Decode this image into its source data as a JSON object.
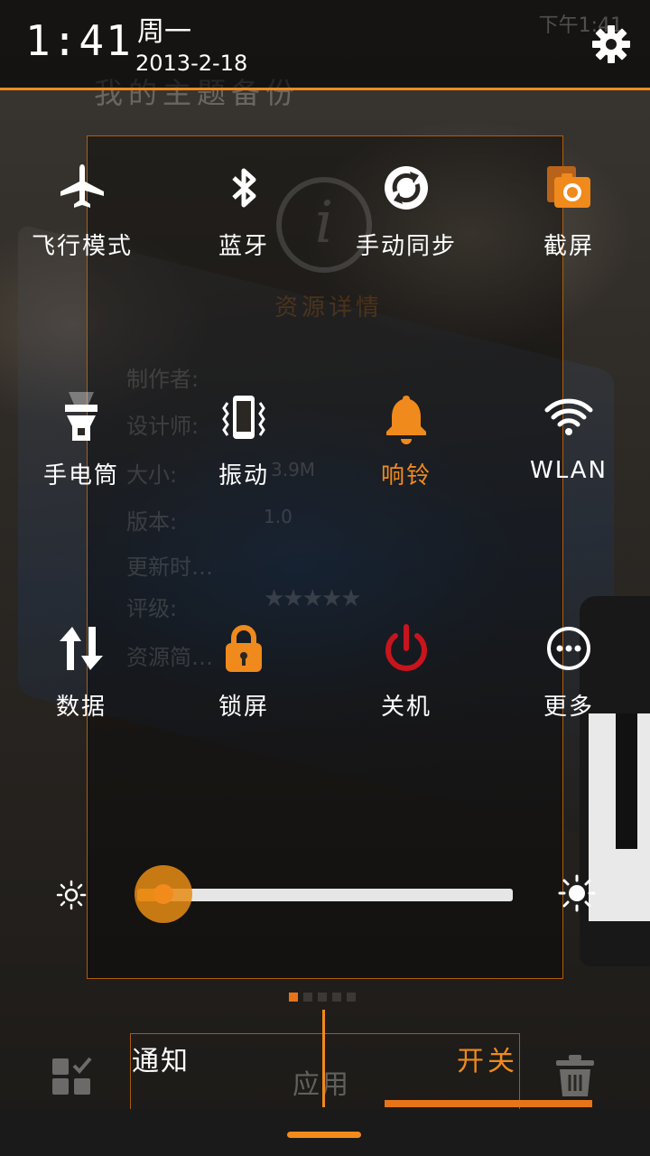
{
  "status_bar": {
    "time": "1:41",
    "weekday": "周一",
    "date": "2013-2-18",
    "right_text": "下午1:41"
  },
  "background": {
    "ghost_title": "我的主题备份",
    "ghost_details_title": "资源详情",
    "ghost_labels": [
      "制作者:",
      "设计师:",
      "大小:",
      "版本:",
      "更新时…",
      "评级:",
      "资源简…"
    ],
    "ghost_size": "3.9M",
    "ghost_version": "1.0",
    "ghost_stars": "★★★★★"
  },
  "toggles": {
    "row1": [
      {
        "label": "飞行模式",
        "icon": "airplane-icon"
      },
      {
        "label": "蓝牙",
        "icon": "bluetooth-icon"
      },
      {
        "label": "手动同步",
        "icon": "sync-icon"
      },
      {
        "label": "截屏",
        "icon": "screenshot-icon"
      }
    ],
    "row2": [
      {
        "label": "手电筒",
        "icon": "flashlight-icon"
      },
      {
        "label": "振动",
        "icon": "vibrate-icon"
      },
      {
        "label": "响铃",
        "icon": "bell-icon",
        "active": true
      },
      {
        "label": "WLAN",
        "icon": "wifi-icon"
      }
    ],
    "row3": [
      {
        "label": "数据",
        "icon": "data-icon"
      },
      {
        "label": "锁屏",
        "icon": "lock-icon"
      },
      {
        "label": "关机",
        "icon": "power-icon"
      },
      {
        "label": "更多",
        "icon": "more-icon"
      }
    ]
  },
  "brightness": {
    "level": 0.07
  },
  "tabs": {
    "notify_label": "通知",
    "apps_label": "应用",
    "switch_label": "开关"
  },
  "page_indicator": {
    "count": 5,
    "active": 0
  },
  "colors": {
    "accent": "#f08a1c",
    "power": "#c8141c"
  }
}
